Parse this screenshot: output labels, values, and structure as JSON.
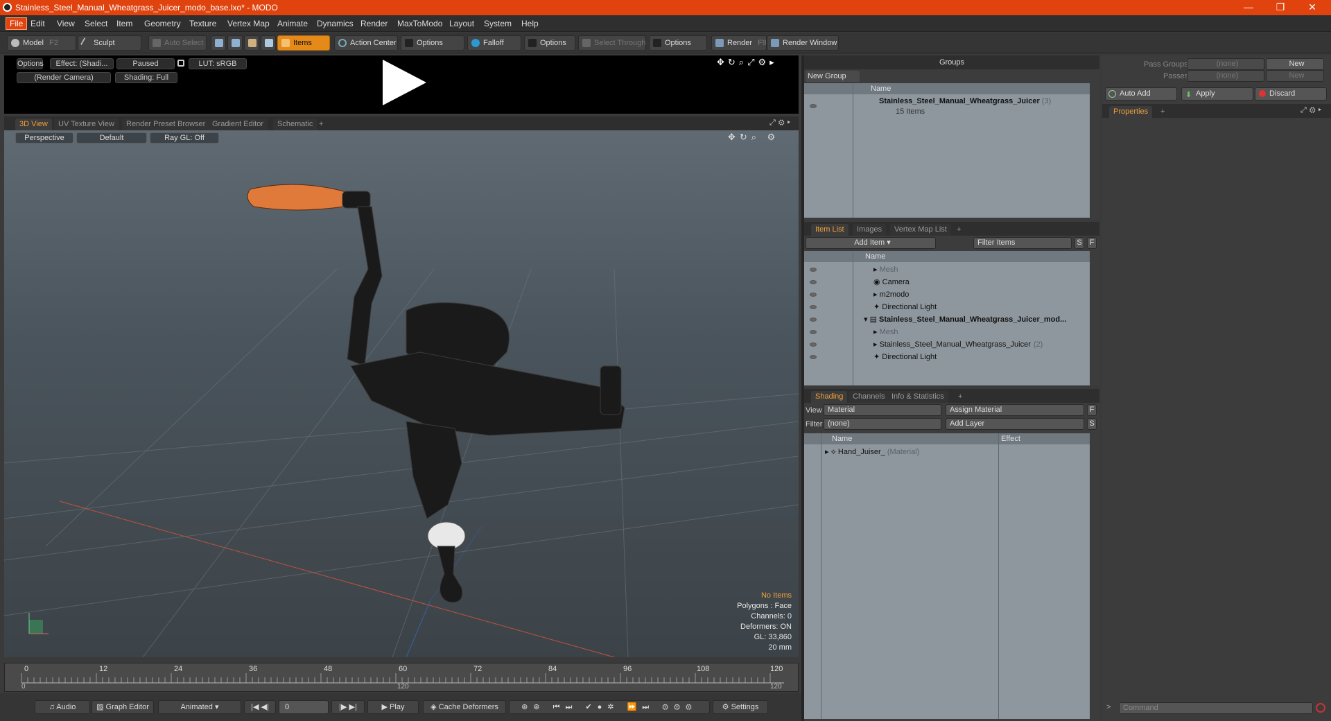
{
  "window": {
    "title": "Stainless_Steel_Manual_Wheatgrass_Juicer_modo_base.lxo* - MODO",
    "minimize": "—",
    "restore": "❐",
    "close": "✕"
  },
  "menu": [
    "File",
    "Edit",
    "View",
    "Select",
    "Item",
    "Geometry",
    "Texture",
    "Vertex Map",
    "Animate",
    "Dynamics",
    "Render",
    "MaxToModo",
    "Layout",
    "System",
    "Help"
  ],
  "toolbar": {
    "model": "Model",
    "model_key": "F2",
    "sculpt": "Sculpt",
    "auto_select": "Auto Select",
    "items": "Items",
    "action_center": "Action Center",
    "options1": "Options",
    "falloff": "Falloff",
    "options2": "Options",
    "select_through": "Select Through",
    "options3": "Options",
    "render": "Render",
    "render_key": "F9",
    "render_window": "Render Window"
  },
  "preview": {
    "options": "Options",
    "effect": "Effect: (Shadi...",
    "paused": "Paused",
    "lut": "LUT: sRGB",
    "camera": "(Render Camera)",
    "shading": "Shading: Full"
  },
  "viewtabs": [
    "3D View",
    "UV Texture View",
    "Render Preset Browser",
    "Gradient Editor",
    "Schematic",
    "+"
  ],
  "viewport": {
    "perspective": "Perspective",
    "default": "Default",
    "raygl": "Ray GL: Off",
    "hud": {
      "no_items": "No Items",
      "polygons": "Polygons : Face",
      "channels": "Channels: 0",
      "deformers": "Deformers: ON",
      "gl": "GL: 33,860",
      "mm": "20 mm"
    }
  },
  "timeline": {
    "ticks": [
      "0",
      "12",
      "24",
      "36",
      "48",
      "60",
      "72",
      "84",
      "96",
      "108",
      "120"
    ],
    "sub_start": "0",
    "sub_mid": "120",
    "sub_end": "120"
  },
  "bottombar": {
    "audio": "Audio",
    "graph_editor": "Graph Editor",
    "animated": "Animated",
    "frame": "0",
    "play": "Play",
    "cache": "Cache Deformers",
    "settings": "Settings"
  },
  "groups": {
    "title": "Groups",
    "new_group": "New Group",
    "col_name": "Name",
    "item_name": "Stainless_Steel_Manual_Wheatgrass_Juicer",
    "item_count": "(3)",
    "item_sub": "15 Items"
  },
  "itemlist": {
    "tabs": [
      "Item List",
      "Images",
      "Vertex Map List",
      "+"
    ],
    "add_item": "Add Item",
    "filter": "Filter Items",
    "s": "S",
    "f": "F",
    "col_name": "Name",
    "rows": [
      {
        "label": "Mesh",
        "dim": true,
        "indent": 1,
        "bold": false
      },
      {
        "label": "Camera",
        "dim": false,
        "indent": 1,
        "bold": false
      },
      {
        "label": "m2modo",
        "dim": false,
        "indent": 1,
        "bold": false
      },
      {
        "label": "Directional Light",
        "dim": false,
        "indent": 1,
        "bold": false
      },
      {
        "label": "Stainless_Steel_Manual_Wheatgrass_Juicer_mod...",
        "dim": false,
        "indent": 0,
        "bold": true
      },
      {
        "label": "Mesh",
        "dim": true,
        "indent": 1,
        "bold": false
      },
      {
        "label": "Stainless_Steel_Manual_Wheatgrass_Juicer",
        "suffix": "(2)",
        "dim": false,
        "indent": 1,
        "bold": false
      },
      {
        "label": "Directional Light",
        "dim": false,
        "indent": 1,
        "bold": false
      }
    ]
  },
  "shading": {
    "tabs": [
      "Shading",
      "Channels",
      "Info & Statistics",
      "+"
    ],
    "view_label": "View",
    "view_value": "Material",
    "assign": "Assign Material",
    "f": "F",
    "filter_label": "Filter",
    "filter_value": "(none)",
    "add_layer": "Add Layer",
    "s": "S",
    "col_name": "Name",
    "col_effect": "Effect",
    "row_name": "Hand_Juiser_",
    "row_type": "(Material)"
  },
  "right": {
    "pass_groups": "Pass Groups",
    "passes": "Passes",
    "none1": "(none)",
    "none2": "(none)",
    "new1": "New",
    "new2": "New",
    "auto_add": "Auto Add",
    "apply": "Apply",
    "discard": "Discard",
    "properties": "Properties",
    "plus": "+",
    "command": "Command"
  }
}
